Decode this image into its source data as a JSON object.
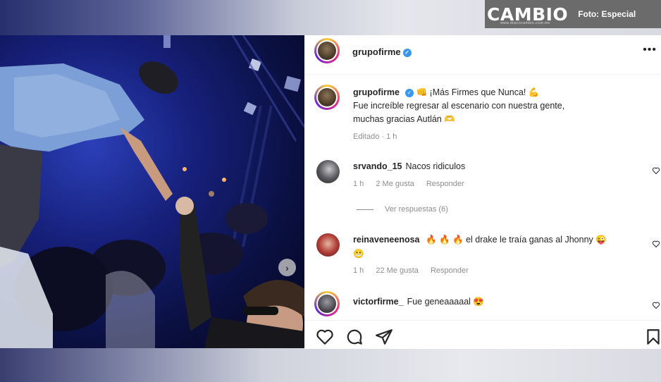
{
  "watermark": {
    "brand": "CAMBIO",
    "site": "www.diariocambio.com.mx",
    "credit": "Foto: Especial"
  },
  "post": {
    "username": "grupofirme",
    "caption_line1": "¡Más Firmes que Nunca!",
    "caption_line2": "Fue increíble regresar al escenario con nuestra gente,",
    "caption_line3": "muchas gracias Autlán",
    "edited": "Editado · 1 h"
  },
  "comments": [
    {
      "username": "srvando_15",
      "text": "Nacos ridiculos",
      "time": "1 h",
      "likes": "2 Me gusta",
      "reply": "Responder",
      "view_replies": "Ver respuestas (6)"
    },
    {
      "username": "reinaveneenosa",
      "text": "el drake le traía ganas al Jhonny",
      "time": "1 h",
      "likes": "22 Me gusta",
      "reply": "Responder"
    },
    {
      "username": "victorfirme_",
      "text": "Fue geneaaaaal"
    }
  ],
  "icons": {
    "more": "more-options-icon",
    "like": "heart-icon",
    "comment": "comment-icon",
    "share": "send-icon",
    "save": "bookmark-icon",
    "next": "chevron-right-icon"
  },
  "colors": {
    "verified": "#3897f0",
    "secondary_text": "#8e8e8e",
    "primary_text": "#262626"
  }
}
